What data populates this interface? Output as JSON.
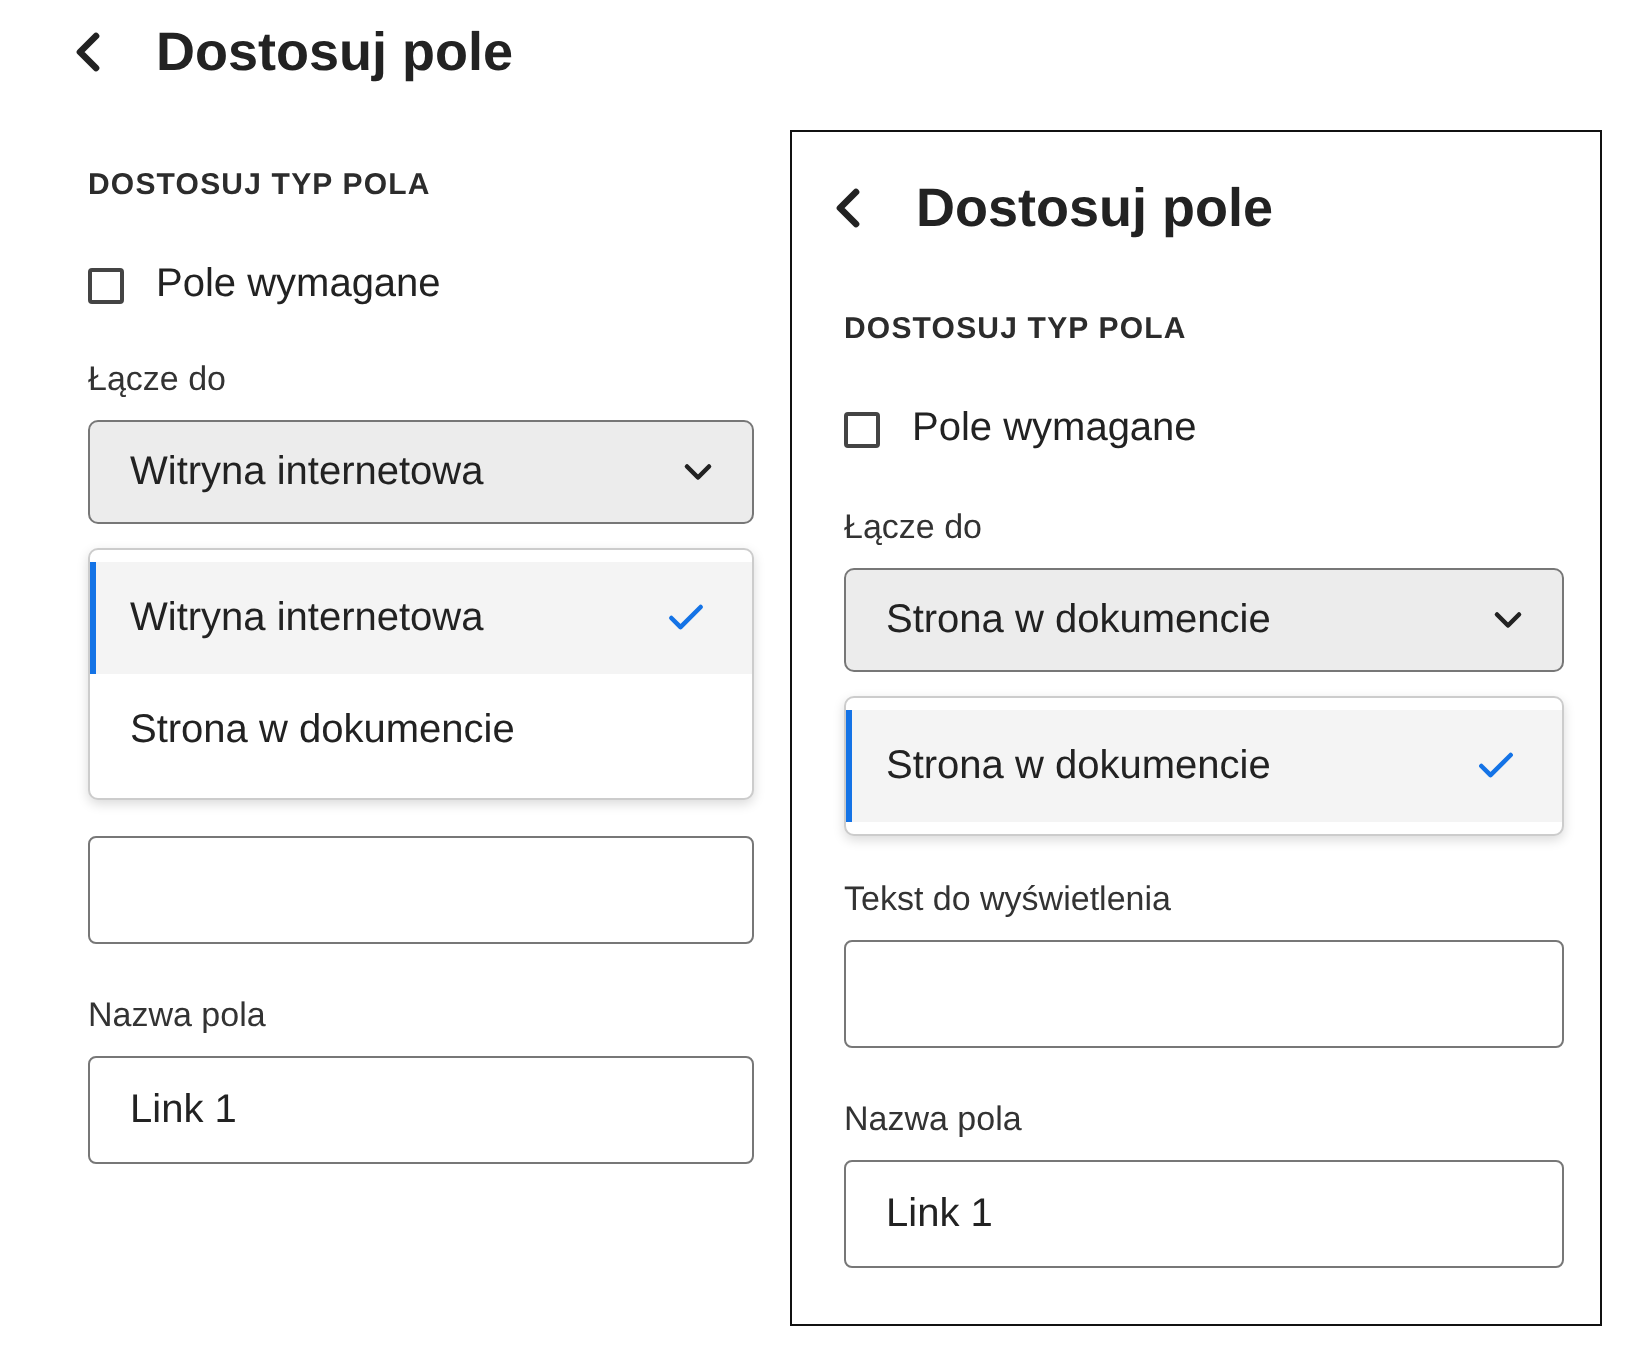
{
  "panels": [
    {
      "title": "Dostosuj pole",
      "section_title": "DOSTOSUJ TYP POLA",
      "required": {
        "label": "Pole wymagane",
        "checked": false
      },
      "link_to": {
        "label": "Łącze do",
        "value": "Witryna internetowa",
        "menu_open": true,
        "options": [
          {
            "label": "Witryna internetowa",
            "selected": true
          },
          {
            "label": "Strona w dokumencie",
            "selected": false
          }
        ]
      },
      "field_name": {
        "label": "Nazwa pola",
        "value": "Link 1"
      }
    },
    {
      "title": "Dostosuj pole",
      "section_title": "DOSTOSUJ TYP POLA",
      "required": {
        "label": "Pole wymagane",
        "checked": false
      },
      "link_to": {
        "label": "Łącze do",
        "value": "Strona w dokumencie",
        "menu_open": true,
        "options": [
          {
            "label": "Strona w dokumencie",
            "selected": true
          }
        ]
      },
      "display_text": {
        "label": "Tekst do wyświetlenia"
      },
      "field_name": {
        "label": "Nazwa pola",
        "value": "Link 1"
      }
    }
  ]
}
